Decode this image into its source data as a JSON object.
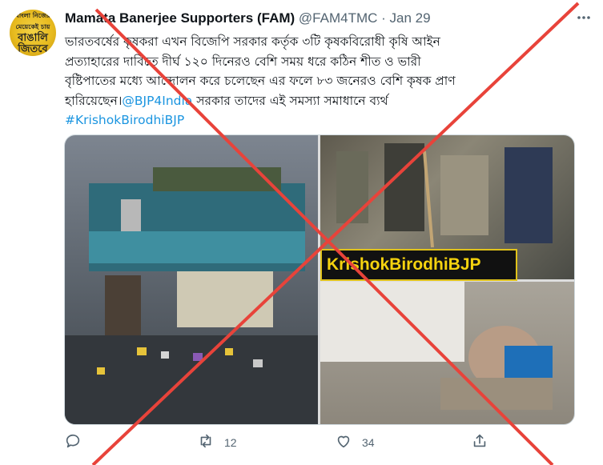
{
  "tweet": {
    "author_name": "Mamata Banerjee Supporters (FAM)",
    "handle": "@FAM4TMC",
    "separator": "·",
    "date": "Jan 29",
    "avatar_text_top": "বাংলা নিজের মেয়েকেই চায়",
    "avatar_text_main": "বাঙালি জিতবে",
    "body_line_1": "ভারতবর্ষের কৃষকরা এখন বিজেপি সরকার কর্তৃক ৩টি কৃষকবিরোধী কৃষি আইন",
    "body_line_2": "প্রত্যাহারের দাবিতে দীর্ঘ ১২০  দিনেরও বেশি সময় ধরে কঠিন শীত ও ভারী",
    "body_line_3": "বৃষ্টিপাতের মধ্যে আন্দোলন করে চলেছেন এর ফলে ৮৩ জনেরও বেশি কৃষক প্রাণ",
    "body_line_4_prefix": "হারিয়েছেন।",
    "mention": "@BJP4India",
    "body_line_4_suffix": " সরকার তাদের এই সমস্যা সমাধানে ব্যর্থ",
    "hashtag": "#KrishokBirodhiBJP",
    "image_banner": "KrishokBirodhiBJP",
    "reply_count": "",
    "retweet_count": "12",
    "like_count": "34"
  },
  "icons": [
    "more-icon",
    "reply-icon",
    "retweet-icon",
    "like-icon",
    "share-icon"
  ],
  "colors": {
    "link": "#1b95e0",
    "secondary_text": "#536471",
    "cross": "#e8433a",
    "banner_text": "#f5d30f"
  }
}
